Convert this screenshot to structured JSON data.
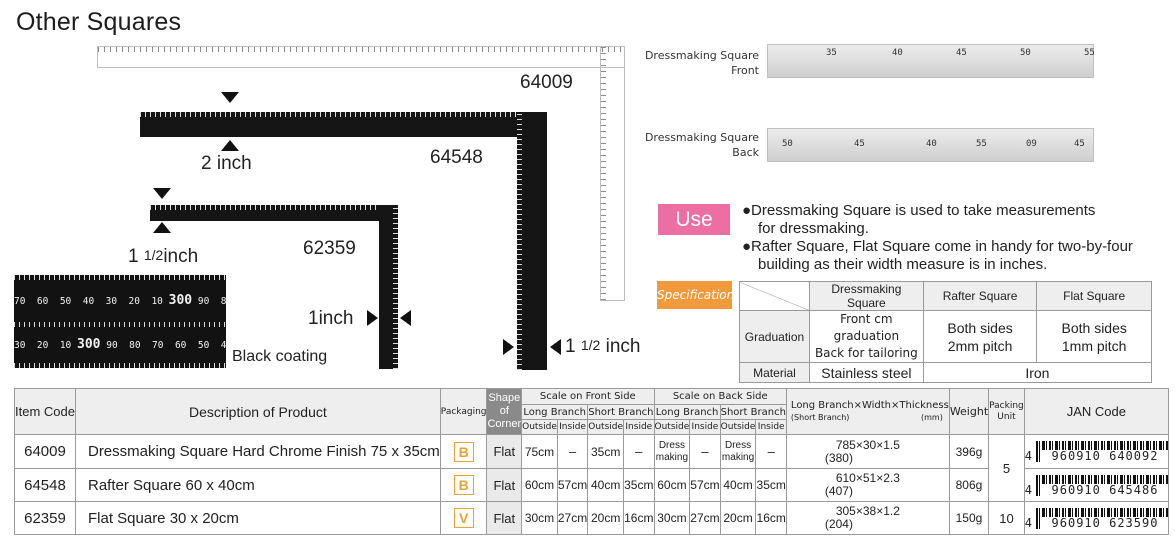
{
  "page_title": "Other Squares",
  "figure": {
    "code_64009": "64009",
    "code_64548": "64548",
    "code_62359": "62359",
    "label_2inch": "2 inch",
    "label_1half_whole": "1",
    "label_1half_frac": "1/2",
    "label_inch": "inch",
    "label_1inch": "1inch",
    "label_right_whole": "1",
    "label_right_frac": "1/2",
    "label_right_inch": "inch",
    "black_coating": "Black coating",
    "closeup_top": [
      "70",
      "60",
      "50",
      "40",
      "30",
      "20",
      "10",
      "300",
      "90",
      "80",
      "70",
      "60",
      "50",
      "40",
      "30",
      "20"
    ],
    "closeup_bottom": [
      "30",
      "20",
      "10",
      "300",
      "90",
      "80",
      "70",
      "60",
      "50",
      "40",
      "30",
      "20",
      "10"
    ]
  },
  "dressmaking": {
    "front_label_1": "Dressmaking Square",
    "front_label_2": "Front",
    "back_label_1": "Dressmaking Square",
    "back_label_2": "Back",
    "front_nums": [
      "35",
      "40",
      "45",
      "50",
      "55"
    ],
    "back_nums": [
      "50",
      "45",
      "40",
      "55",
      "09",
      "45"
    ]
  },
  "use": {
    "badge": "Use",
    "line1": "●Dressmaking Square is used to take measurements",
    "line1b": "for dressmaking.",
    "line2": "●Rafter Square, Flat Square come in handy for two-by-four",
    "line2b": "building as their width measure is in inches."
  },
  "specifications": {
    "badge": "Specifications",
    "headers": [
      "Dressmaking Square",
      "Rafter Square",
      "Flat Square"
    ],
    "graduation_label": "Graduation",
    "graduation": [
      {
        "l1": "Front cm graduation",
        "l2": "Back for tailoring"
      },
      {
        "l1": "Both sides",
        "l2": "2mm pitch"
      },
      {
        "l1": "Both sides",
        "l2": "1mm pitch"
      }
    ],
    "material_label": "Material",
    "material_dress": "Stainless steel",
    "material_other": "Iron"
  },
  "table": {
    "headers": {
      "item_code": "Item Code",
      "description": "Description of Product",
      "packaging": "Packaging",
      "shape": "Shape of Corner",
      "scale_front": "Scale on Front Side",
      "scale_back": "Scale on Back Side",
      "long_branch": "Long Branch",
      "short_branch": "Short Branch",
      "outside": "Outside",
      "inside": "Inside",
      "dims": "Long Branch×Width×Thickness",
      "dims_sub": "(Short Branch)",
      "dims_unit": "(mm)",
      "weight": "Weight",
      "packing_unit": "Packing Unit",
      "jan": "JAN Code"
    },
    "rows": [
      {
        "code": "64009",
        "desc": "Dressmaking Square Hard Chrome Finish 75 x 35cm",
        "pack": "B",
        "shape": "Flat",
        "f": [
          "75cm",
          "–",
          "35cm",
          "–"
        ],
        "b": [
          "Dress making",
          "–",
          "Dress making",
          "–"
        ],
        "dims": "785×30×1.5",
        "short": "(380)",
        "weight": "396g",
        "jan_lead": "4",
        "jan": "960910 640092"
      },
      {
        "code": "64548",
        "desc": "Rafter Square 60 x 40cm",
        "pack": "B",
        "shape": "Flat",
        "f": [
          "60cm",
          "57cm",
          "40cm",
          "35cm"
        ],
        "b": [
          "60cm",
          "57cm",
          "40cm",
          "35cm"
        ],
        "dims": "610×51×2.3",
        "short": "(407)",
        "weight": "806g",
        "jan_lead": "4",
        "jan": "960910 645486"
      },
      {
        "code": "62359",
        "desc": "Flat Square 30 x 20cm",
        "pack": "V",
        "shape": "Flat",
        "f": [
          "30cm",
          "27cm",
          "20cm",
          "16cm"
        ],
        "b": [
          "30cm",
          "27cm",
          "20cm",
          "16cm"
        ],
        "dims": "305×38×1.2",
        "short": "(204)",
        "weight": "150g",
        "jan_lead": "4",
        "jan": "960910 623590"
      }
    ],
    "packing_5": "5",
    "packing_10": "10"
  }
}
